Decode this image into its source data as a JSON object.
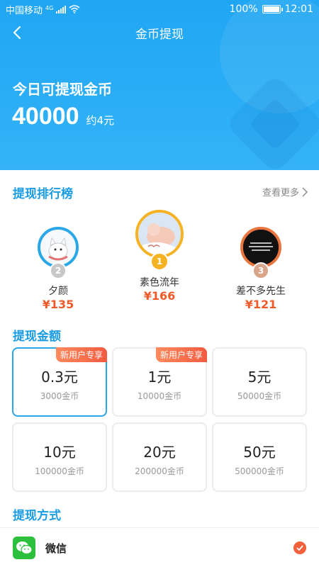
{
  "status": {
    "carrier": "中国移动",
    "network": "4G",
    "battery": "100%",
    "battery_level": 1.0,
    "time": "12:01"
  },
  "nav": {
    "title": "金币提现"
  },
  "balance": {
    "label": "今日可提现金币",
    "value": "40000",
    "approx": "约4元"
  },
  "ranking": {
    "title": "提现排行榜",
    "see_more": "查看更多",
    "items": [
      {
        "rank": "2",
        "name": "夕颜",
        "amount": "¥135"
      },
      {
        "rank": "1",
        "name": "素色流年",
        "amount": "¥166"
      },
      {
        "rank": "3",
        "name": "差不多先生",
        "amount": "¥121"
      }
    ]
  },
  "amounts": {
    "title": "提现金额",
    "options": [
      {
        "yuan": "0.3元",
        "coins": "3000金币",
        "badge": "新用户专享"
      },
      {
        "yuan": "1元",
        "coins": "10000金币",
        "badge": "新用户专享"
      },
      {
        "yuan": "5元",
        "coins": "50000金币",
        "badge": ""
      },
      {
        "yuan": "10元",
        "coins": "100000金币",
        "badge": ""
      },
      {
        "yuan": "20元",
        "coins": "200000金币",
        "badge": ""
      },
      {
        "yuan": "50元",
        "coins": "500000金币",
        "badge": ""
      }
    ],
    "selected_index": 0
  },
  "methods": {
    "title": "提现方式",
    "wechat": "微信"
  },
  "colors": {
    "primary": "#1fa6f3",
    "accent": "#f05a28",
    "wechat": "#2cc03c"
  }
}
